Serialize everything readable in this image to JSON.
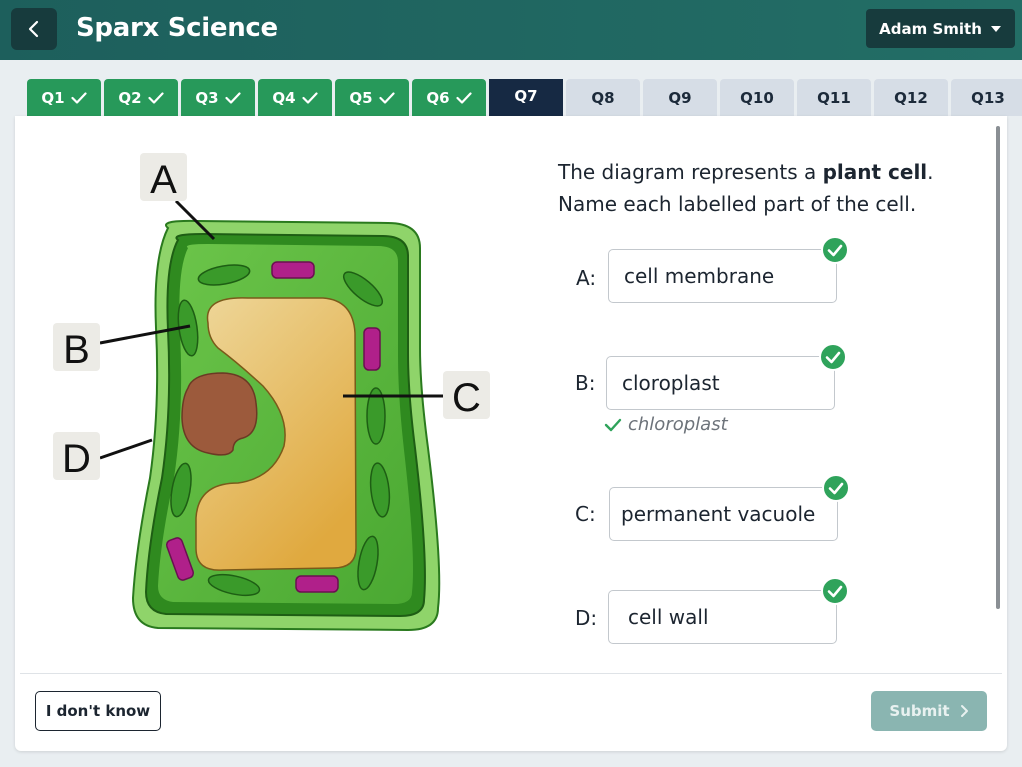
{
  "header": {
    "back_icon": "chevron-left-icon",
    "title": "Sparx Science",
    "user_name": "Adam Smith",
    "user_menu_icon": "caret-down-icon"
  },
  "tabs": [
    {
      "label": "Q1",
      "state": "done"
    },
    {
      "label": "Q2",
      "state": "done"
    },
    {
      "label": "Q3",
      "state": "done"
    },
    {
      "label": "Q4",
      "state": "done"
    },
    {
      "label": "Q5",
      "state": "done"
    },
    {
      "label": "Q6",
      "state": "done"
    },
    {
      "label": "Q7",
      "state": "current"
    },
    {
      "label": "Q8",
      "state": "todo"
    },
    {
      "label": "Q9",
      "state": "todo"
    },
    {
      "label": "Q10",
      "state": "todo"
    },
    {
      "label": "Q11",
      "state": "todo"
    },
    {
      "label": "Q12",
      "state": "todo"
    },
    {
      "label": "Q13",
      "state": "todo"
    }
  ],
  "diagram": {
    "labels": [
      "A",
      "B",
      "C",
      "D"
    ]
  },
  "question": {
    "line1_prefix": "The diagram represents a ",
    "line1_bold": "plant cell",
    "line1_suffix": ".",
    "line2": "Name each labelled part of the cell."
  },
  "answers": [
    {
      "label": "A:",
      "value": "cell membrane",
      "status": "correct"
    },
    {
      "label": "B:",
      "value": "cloroplast",
      "status": "correct"
    },
    {
      "label": "C:",
      "value": "permanent vacuole",
      "status": "correct"
    },
    {
      "label": "D:",
      "value": "cell wall",
      "status": "correct"
    }
  ],
  "correction": {
    "text": "chloroplast"
  },
  "footer": {
    "idk_label": "I don't know",
    "submit_label": "Submit"
  },
  "colors": {
    "done_tab": "#27995a",
    "current_tab": "#162943",
    "todo_tab": "#d6dde6",
    "correct": "#2fa35b",
    "header": "#1f6b64"
  }
}
